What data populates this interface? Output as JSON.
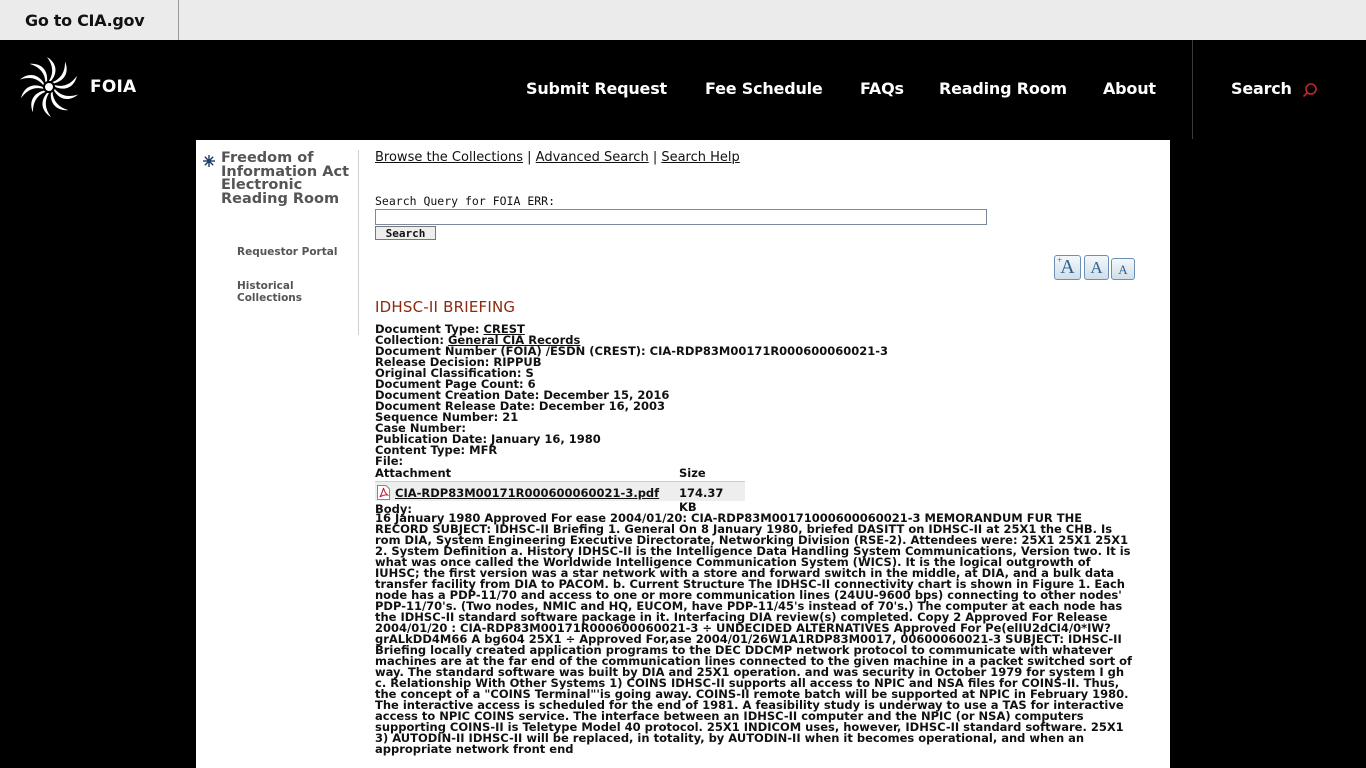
{
  "utility": {
    "go_to": "Go to CIA.gov"
  },
  "header": {
    "brand": "FOIA",
    "nav": [
      "Submit Request",
      "Fee Schedule",
      "FAQs",
      "Reading Room",
      "About"
    ],
    "search": "Search"
  },
  "sidebar": {
    "title": "Freedom of Information Act Electronic Reading Room",
    "links": [
      "Requestor Portal",
      "Historical Collections"
    ]
  },
  "links": {
    "browse": "Browse the Collections",
    "sep": " | ",
    "advanced": "Advanced Search",
    "help": "Search Help"
  },
  "search": {
    "label": "Search Query for FOIA ERR:",
    "value": "",
    "button": "Search"
  },
  "font_sizes": [
    "A",
    "A",
    "A"
  ],
  "document": {
    "title": "IDHSC-II BRIEFING",
    "type_label": "Document Type:",
    "type_value": "CREST",
    "collection_label": "Collection:",
    "collection_value": "General CIA Records",
    "number": "Document Number (FOIA) /ESDN (CREST): CIA-RDP83M00171R000600060021-3",
    "release_decision": "Release Decision: RIPPUB",
    "classification": "Original Classification: S",
    "page_count": "Document Page Count: 6",
    "creation_date": "Document Creation Date: December 15, 2016",
    "release_date": "Document Release Date: December 16, 2003",
    "sequence": "Sequence Number: 21",
    "case_number": "Case Number:",
    "publication_date": "Publication Date: January 16, 1980",
    "content_type": "Content Type: MFR",
    "file": "File:",
    "attachment_header": "Attachment",
    "size_header": "Size",
    "attachment_name": "CIA-RDP83M00171R000600060021-3.pdf",
    "attachment_size": "174.37 KB",
    "body_label": "Body:",
    "body": "16 January 1980 Approved For ease 2004/01/20: CIA-RDP83M00171000600060021-3 MEMORANDUM FUR THE RECORD SUBJECT: IDHSC-II Briefing 1. General On 8 January 1980, briefed DASITT on IDHSC-II at 25X1 the CHB. Is rom DIA, System Engineering Executive Directorate, Networking Division (RSE-2). Attendees were: 25X1 25X1 25X1 2. System Definition a. History IDHSC-II is the Intelligence Data Handling System Communications, Version two. It is what was once called the Worldwide Intelligence Communication System (WICS). It is the logical outgrowth of IUHSC; the first version was a star network with a store and forward switch in the middle, at DIA, and a bulk data transfer facility from DIA to PACOM. b. Current Structure The IDHSC-II connectivity chart is shown in Figure 1. Each node has a PDP-11/70 and access to one or more communication lines (24UU-9600 bps) connecting to other nodes' PDP-11/70's. (Two nodes, NMIC and HQ, EUCOM, have PDP-11/45's instead of 70's.) The computer at each node has the IDHSC-II standard software package in it. Interfacing DIA review(s) completed. Copy 2 Approved For Release 2004/01/20 : CIA-RDP83M00171R000600060021-3 ÷ UNDECIDED ALTERNATIVES Approved For Pe(elIU2dCI4/0*IW?grALkDD4M66 A bg604 25X1 ÷ Approved For,ase 2004/01/26W1A1RDP83M0017, 00600060021-3 SUBJECT: IDHSC-II Briefing locally created application programs to the DEC DDCMP network protocol to communicate with whatever machines are at the far end of the communication lines connected to the given machine in a packet switched sort of way. The standard software was built by DIA and 25X1 operation. and was security in October 1979 for system I gh c. Relationship With Other Systems 1) COINS IDHSC-II supports all access to NPIC and NSA files for COINS-II. Thus, the concept of a \"COINS Terminal\"'is going away. COINS-II remote batch will be supported at NPIC in February 1980. The interactive access is scheduled for the end of 1981. A feasibility study is underway to use a TAS for interactive access to NPIC COINS service. The interface between an IDHSC-II computer and the NPIC (or NSA) computers supporting COINS-II is Teletype Model 40 protocol. 25X1 INDICOM uses, however, IDHSC-II standard software. 25X1 3) AUTODIN-II IDHSC-II will be replaced, in totality, by AUTODIN-II when it becomes operational, and when an appropriate network front end"
  }
}
